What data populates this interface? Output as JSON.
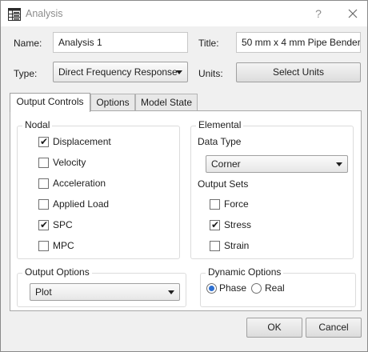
{
  "window": {
    "title": "Analysis",
    "help_glyph": "?",
    "icons": {
      "app": "table-grid-icon",
      "close": "close-icon"
    }
  },
  "header": {
    "name_label": "Name:",
    "name_value": "Analysis 1",
    "title_label": "Title:",
    "title_value": "50 mm x 4 mm Pipe Bender",
    "type_label": "Type:",
    "type_value": "Direct Frequency Response",
    "units_label": "Units:",
    "select_units_button": "Select Units"
  },
  "tabs": [
    {
      "label": "Output Controls",
      "active": true
    },
    {
      "label": "Options",
      "active": false
    },
    {
      "label": "Model State",
      "active": false
    }
  ],
  "nodal": {
    "title": "Nodal",
    "items": [
      {
        "label": "Displacement",
        "checked": true
      },
      {
        "label": "Velocity",
        "checked": false
      },
      {
        "label": "Acceleration",
        "checked": false
      },
      {
        "label": "Applied Load",
        "checked": false
      },
      {
        "label": "SPC",
        "checked": true
      },
      {
        "label": "MPC",
        "checked": false
      }
    ]
  },
  "elemental": {
    "title": "Elemental",
    "data_type_label": "Data Type",
    "data_type_value": "Corner",
    "output_sets_label": "Output Sets",
    "items": [
      {
        "label": "Force",
        "checked": false
      },
      {
        "label": "Stress",
        "checked": true
      },
      {
        "label": "Strain",
        "checked": false
      }
    ]
  },
  "output_options": {
    "title": "Output Options",
    "value": "Plot"
  },
  "dynamic_options": {
    "title": "Dynamic Options",
    "options": [
      {
        "label": "Phase",
        "selected": true
      },
      {
        "label": "Real",
        "selected": false
      }
    ]
  },
  "footer": {
    "ok_label": "OK",
    "cancel_label": "Cancel"
  }
}
